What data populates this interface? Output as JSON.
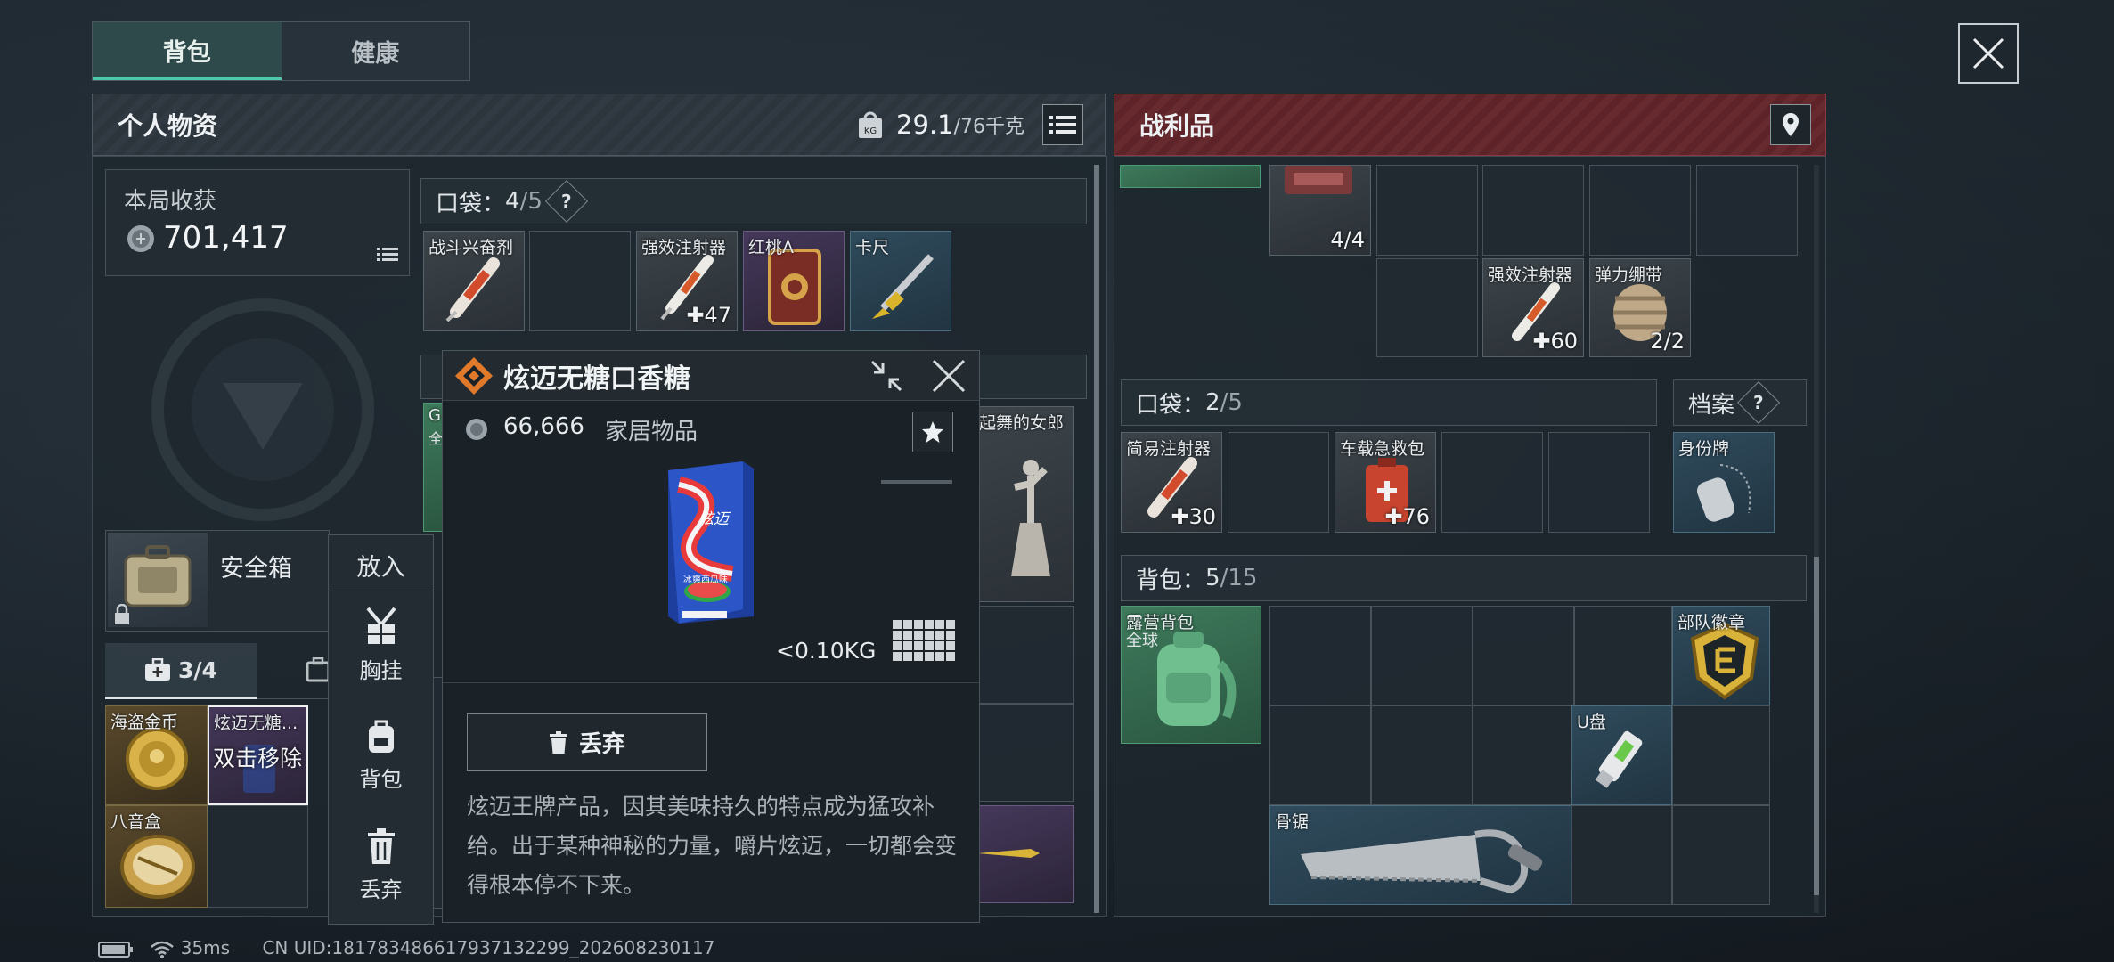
{
  "tabs": {
    "backpack": "背包",
    "health": "健康"
  },
  "left_panel": {
    "title": "个人物资",
    "weight_current": "29.1",
    "weight_max": "/76千克"
  },
  "earnings": {
    "label": "本局收获",
    "value": "701,417"
  },
  "safe_box": {
    "label": "安全箱"
  },
  "container_tab": {
    "count": "3/4"
  },
  "safe_items": [
    {
      "name": "海盗金币"
    },
    {
      "name": "炫迈无糖...",
      "overlay": "双击移除"
    },
    {
      "name": "八音盒"
    }
  ],
  "pocket": {
    "label": "口袋：",
    "count": "4",
    "max": "/5",
    "help": "?",
    "items": [
      {
        "name": "战斗兴奋剂",
        "count": ""
      },
      {
        "name": "",
        "count": ""
      },
      {
        "name": "强效注射器",
        "count": "✚47"
      },
      {
        "name": "红桃A",
        "count": ""
      },
      {
        "name": "卡尺",
        "count": ""
      }
    ]
  },
  "partial_items": {
    "dancer_label": "起舞的女郎",
    "g_label": "G",
    "g_sub": "全"
  },
  "side_menu": {
    "put_in": "放入",
    "chest": "胸挂",
    "backpack": "背包",
    "discard": "丢弃"
  },
  "popup": {
    "title": "炫迈无糖口香糖",
    "price": "66,666",
    "category": "家居物品",
    "weight": "<0.10KG",
    "discard_label": "丢弃",
    "description": "炫迈王牌产品，因其美味持久的特点成为猛攻补给。出于某种神秘的力量，嚼片炫迈，一切都会变得根本停不下来。",
    "pack_text_1": "炫迈",
    "pack_text_2": "冰爽西瓜味"
  },
  "right_panel": {
    "title": "战利品",
    "top_items": [
      {
        "name": "",
        "count": "4/4"
      },
      {
        "name": "强效注射器",
        "count": "✚60"
      },
      {
        "name": "弹力绷带",
        "count": "2/2"
      }
    ],
    "pocket": {
      "label": "口袋：",
      "count": "2",
      "max": "/5",
      "items": [
        {
          "name": "简易注射器",
          "count": "✚30"
        },
        {
          "name": "车载急救包",
          "count": "✚76"
        }
      ]
    },
    "archive": {
      "label": "档案",
      "help": "?",
      "item": "身份牌"
    },
    "backpack": {
      "label": "背包：",
      "count": "5",
      "max": "/15",
      "items": [
        {
          "name": "露营背包",
          "sub": "全球"
        },
        {
          "name": "部队徽章"
        },
        {
          "name": "U盘"
        },
        {
          "name": "骨锯"
        }
      ]
    }
  },
  "status_bar": {
    "ping": "35ms",
    "uid": "CN UID:18178348661793713​2299_202608230117"
  },
  "colors": {
    "accent_green": "#4ec9a8",
    "loot_red": "#7a2a30",
    "bg": "#1d262e"
  }
}
